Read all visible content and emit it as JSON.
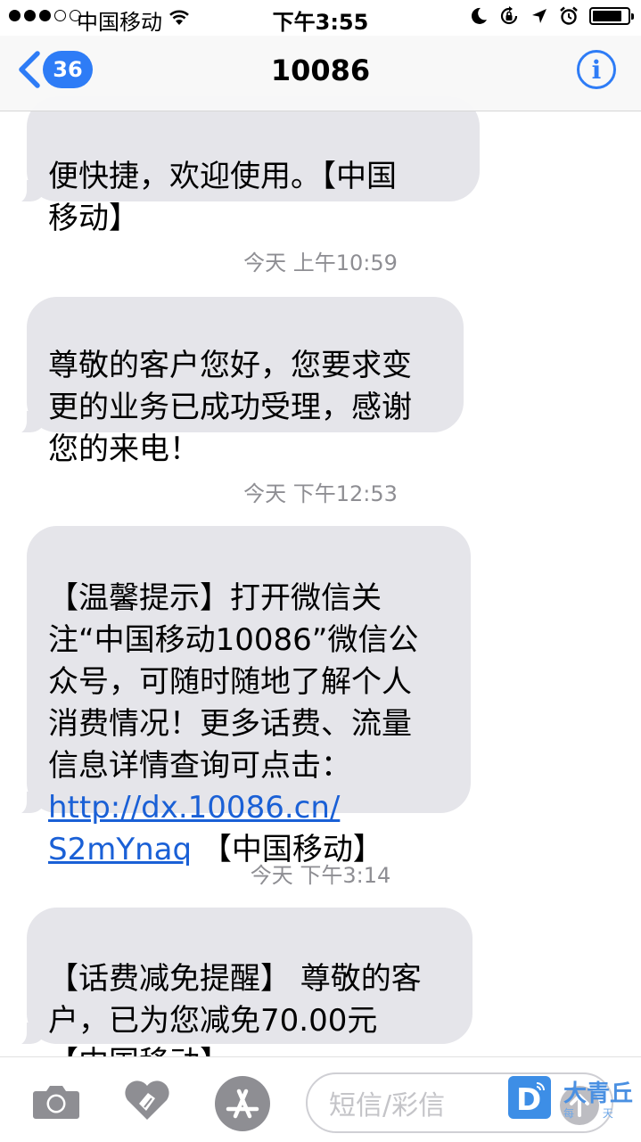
{
  "status_bar": {
    "carrier": "中国移动",
    "time": "下午3:55"
  },
  "nav": {
    "back_count": "36",
    "title": "10086",
    "info_glyph": "i"
  },
  "messages": [
    {
      "text": "便快捷，欢迎使用。【中国\n移动】"
    },
    {
      "timestamp": "今天 上午10:59",
      "text": "尊敬的客户您好，您要求变\n更的业务已成功受理，感谢\n您的来电！"
    },
    {
      "timestamp": "今天 下午12:53",
      "text_before": "【温馨提示】打开微信关\n注“中国移动10086”微信公\n众号，可随时随地了解个人\n消费情况！更多话费、流量\n信息详情查询可点击：\n",
      "link": "http://dx.10086.cn/\nS2mYnaq",
      "text_after": " 【中国移动】"
    },
    {
      "timestamp": "今天 下午3:14",
      "text": "【话费减免提醒】 尊敬的客\n户，已为您减免70.00元\n【中国移动】"
    }
  ],
  "composer": {
    "placeholder": "短信/彩信"
  },
  "watermark": {
    "text": "大青丘",
    "small_chars": "每 天"
  },
  "colors": {
    "accent": "#2e7cf6",
    "bubble": "#e5e5ea",
    "timestamp": "#8e8e93",
    "link": "#1a60d6"
  },
  "icons": [
    "wifi-icon",
    "moon-icon",
    "rotation-lock-icon",
    "location-arrow-icon",
    "alarm-icon",
    "battery-icon",
    "back-chevron-icon",
    "info-icon",
    "camera-icon",
    "digital-touch-heart-icon",
    "app-store-icon",
    "send-arrow-icon"
  ]
}
